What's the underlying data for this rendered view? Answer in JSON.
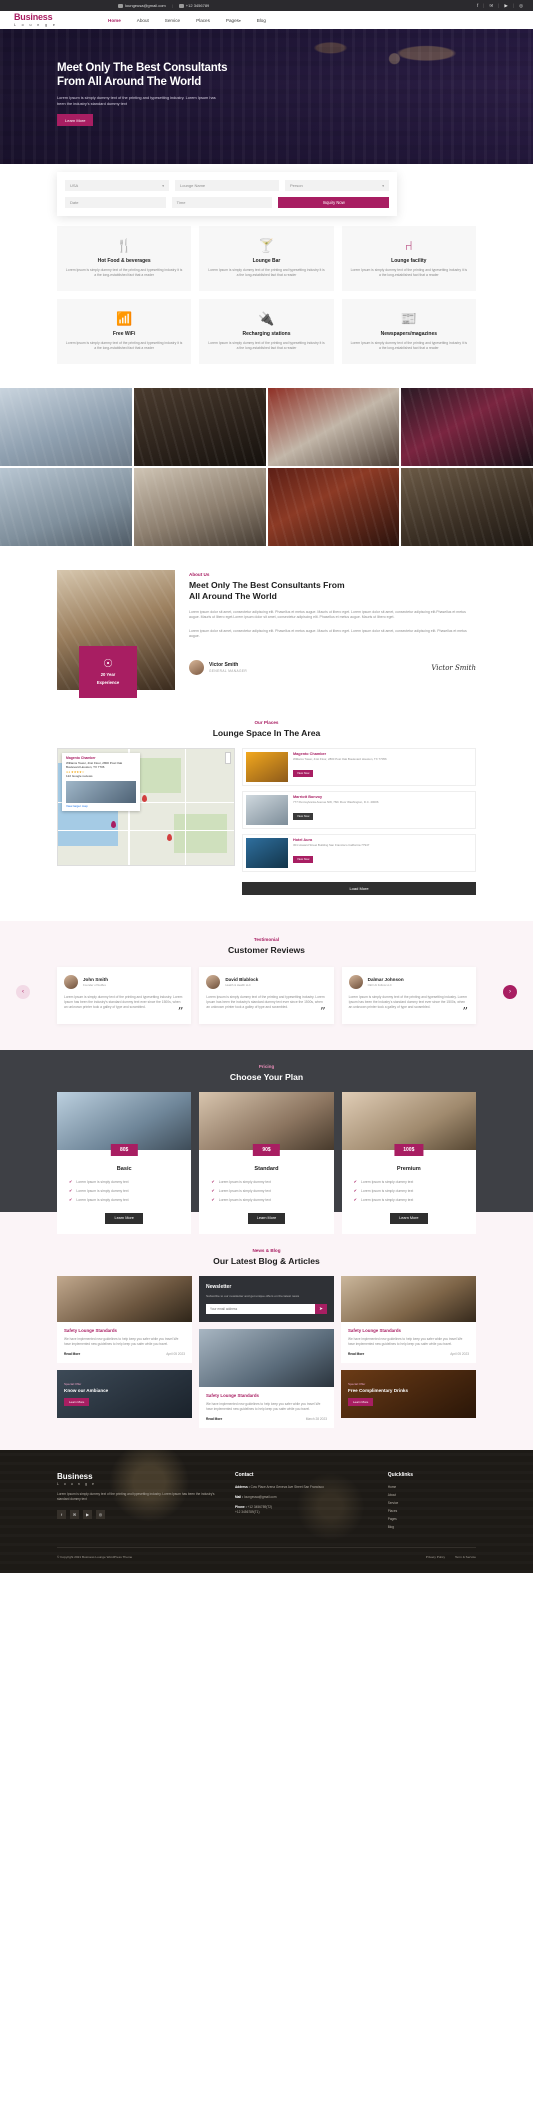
{
  "topbar": {
    "email": "loungeusa@gmail.com",
    "phone": "+12 3456789",
    "email_icon": "mail-icon",
    "phone_icon": "phone-icon",
    "social": [
      {
        "name": "facebook-icon",
        "glyph": "f"
      },
      {
        "name": "twitter-icon",
        "glyph": "✉"
      },
      {
        "name": "youtube-icon",
        "glyph": "▶"
      },
      {
        "name": "instagram-icon",
        "glyph": "◎"
      }
    ]
  },
  "brand": {
    "name": "Business",
    "sub": "L o u n g e"
  },
  "nav": {
    "items": [
      {
        "label": "Home",
        "active": true
      },
      {
        "label": "About",
        "active": false
      },
      {
        "label": "Service",
        "active": false
      },
      {
        "label": "Places",
        "active": false
      },
      {
        "label": "Pages",
        "active": false,
        "caret": "▾"
      },
      {
        "label": "Blog",
        "active": false
      }
    ]
  },
  "hero": {
    "title_line1": "Meet Only The Best Consultants",
    "title_line2": "From All Around The World",
    "paragraph": "Lorem Ipsum is simply dummy text of the printing and typesetting industry. Lorem Ipsum has been the industry's standard dummy text",
    "cta": "Learn More"
  },
  "booking": {
    "country": "USA",
    "country_caret": "▾",
    "lounge": "Lounge Name",
    "person": "Person",
    "date": "Date",
    "time": "Time",
    "submit": "Inquiry Now"
  },
  "services": {
    "cards": [
      {
        "icon": "cutlery-icon",
        "glyph": "🍴",
        "title": "Hot Food & beverages",
        "text": "Lorem Ipsum is simply dummy text of the printing and typesetting industry it is a the long-established fact that a reader"
      },
      {
        "icon": "cocktail-icon",
        "glyph": "🍸",
        "title": "Lounge Bar",
        "text": "Lorem Ipsum is simply dummy text of the printing and typesetting industry it is a the long-established fact that a reader"
      },
      {
        "icon": "lounge-chair-icon",
        "glyph": "⑁",
        "title": "Lounge facility",
        "text": "Lorem Ipsum is simply dummy text of the printing and typesetting industry it is a the long-established fact that a reader"
      },
      {
        "icon": "wifi-icon",
        "glyph": "📶",
        "title": "Free WiFi",
        "text": "Lorem Ipsum is simply dummy text of the printing and typesetting industry it is a the long-established fact that a reader"
      },
      {
        "icon": "battery-charge-icon",
        "glyph": "🔌",
        "title": "Recharging stations",
        "text": "Lorem Ipsum is simply dummy text of the printing and typesetting industry it is a the long-established fact that a reader"
      },
      {
        "icon": "newspaper-icon",
        "glyph": "📰",
        "title": "Newspapers/magazines",
        "text": "Lorem Ipsum is simply dummy text of the printing and typesetting industry it is a the long-established fact that a reader"
      }
    ]
  },
  "gallery": {
    "row1": [
      "airport-lounge-photo",
      "garden-lounge-photo",
      "red-interior-photo",
      "bar-night-photo"
    ],
    "row2": [
      "library-lounge-photo",
      "dining-room-photo",
      "billiards-room-photo",
      "people-lounge-photo"
    ]
  },
  "about": {
    "eyebrow": "About Us",
    "title_line1": "Meet Only The Best Consultants From",
    "title_line2": "All Around The World",
    "badge_years": "20 Year",
    "badge_label": "Experience",
    "badge_icon": "award-medal-icon",
    "p1": "Lorem ipsum dolor sit amet, consectetur adipiscing elit. Phasellus et metus augue. Mauris ut libero eget. Lorem ipsum dolor sit amet, consectetur adipiscing elit.Phasellus et metus augue. Mauris ut libero eget.Lorem ipsum dolor sit amet, consectetur adipiscing elit. Phasellus et metus augue. Mauris ut libero eget.",
    "p2": "Lorem ipsum dolor sit amet, consectetur adipiscing elit. Phasellus et metus augue. Mauris ut libero eget. Lorem ipsum dolor sit amet, consectetur adipiscing elit. Phasellus et metus augue.",
    "author_name": "Victor Smith",
    "author_role": "GENERAL MANAGER",
    "signature": "Victor Smith"
  },
  "places": {
    "eyebrow": "Our Places",
    "title": "Lounge Space In The Area",
    "map_card": {
      "title": "Magento Chamber",
      "address": "Williams Tower, 41st Floor, 2800 Post Oak Boulevard Houston, TX 7706",
      "rating": "4.1 ★★★★☆",
      "reviews": "122 Google reviews",
      "link": "View larger map"
    },
    "items": [
      {
        "name": "Magento Chamber",
        "address": "Williams Tower, 41st Floor, 2800 Post Oak Boulevard Houston, TX 77056",
        "button": "View Now",
        "thumb": "orange-meeting-room-photo"
      },
      {
        "name": "Marriott Bonvoy",
        "address": "777 Pennsylvania Avenue NW, 76th Floor Washington, D.C. 20006",
        "button": "View Now",
        "thumb": "white-conference-room-photo"
      },
      {
        "name": "Hotel Aura",
        "address": "301 Howard Street Building San Francisco California 77947",
        "button": "View Now",
        "thumb": "blue-lounge-photo"
      }
    ],
    "load_more": "Load More"
  },
  "testimonial": {
    "eyebrow": "Testimonial",
    "title": "Customer Reviews",
    "cards": [
      {
        "name": "John Smith",
        "role": "Founder of Netflex",
        "text": "Lorem Ipsum is simply dummy text of the printing and typesetting industry. Lorem Ipsum has been the industry's standard dummy text ever since the 1500s, when an unknown printer took a galley of type and scrambled."
      },
      {
        "name": "David Blablock",
        "role": "Health & Health LLC",
        "text": "Lorem Ipsum is simply dummy text of the printing and typesetting industry. Lorem Ipsum has been the industry's standard dummy text ever since the 1500s, when an unknown printer took a galley of type and scrambled."
      },
      {
        "name": "Dalmar Johnson",
        "role": "CEO At Follow LLC",
        "text": "Lorem Ipsum is simply dummy text of the printing and typesetting industry. Lorem Ipsum has been the industry's standard dummy text ever since the 1500s, when an unknown printer took a galley of type and scrambled."
      }
    ],
    "prev": "‹",
    "next": "›",
    "quote_glyph": "”"
  },
  "pricing": {
    "eyebrow": "Pricing",
    "title": "Choose Your  Plan",
    "plans": [
      {
        "price": "80$",
        "name": "Basic",
        "features": [
          "Lorem Ipsum is simply dummy text",
          "Lorem Ipsum is simply dummy text",
          "Lorem Ipsum is simply dummy text"
        ],
        "button": "Learn More"
      },
      {
        "price": "90$",
        "name": "Standard",
        "features": [
          "Lorem Ipsum is simply dummy text",
          "Lorem Ipsum is simply dummy text",
          "Lorem Ipsum is simply dummy text"
        ],
        "button": "Learn More"
      },
      {
        "price": "100$",
        "name": "Premium",
        "features": [
          "Lorem Ipsum is simply dummy text",
          "Lorem Ipsum is simply dummy text",
          "Lorem Ipsum is simply dummy text"
        ],
        "button": "Learn More"
      }
    ],
    "check_glyph": "✔"
  },
  "blog": {
    "eyebrow": "News & Blog",
    "title": "Our Latest Blog & Articles",
    "posts": [
      {
        "title": "Safety Lounge Standards",
        "text": "We have implemented new guidelines to help keep you safer while you travel.We have implemented new guidelines to help keep you safer while you travel.",
        "read_more": "Read More",
        "date": "April 05 2023",
        "thumb": "cafe-people-photo"
      },
      {
        "title": "Safety Lounge Standards",
        "text": "We have implemented new guidelines to help keep you safer while you travel.We have implemented new guidelines to help keep you safer while you travel.",
        "read_more": "Read More",
        "date": "March 28 2023",
        "thumb": "hotel-checkin-photo"
      },
      {
        "title": "Safety Lounge Standards",
        "text": "We have implemented new guidelines to help keep you safer while you travel.We have implemented new guidelines to help keep you safer while you travel.",
        "read_more": "Read More",
        "date": "April 05 2023",
        "thumb": "coworking-photo"
      }
    ],
    "newsletter": {
      "title": "Newsletter",
      "text": "Subscribe to our newsletter and get unique offers on the latest news",
      "placeholder": "Your email address",
      "button": "➤"
    },
    "offers": [
      {
        "tag": "Special Offer",
        "title": "Know our Ambiance",
        "button": "Learn More",
        "thumb": "ambiance-photo"
      },
      {
        "tag": "Special Offer",
        "title": "Free Complimentary Drinks",
        "button": "Learn More",
        "thumb": "drinks-photo"
      }
    ]
  },
  "footer": {
    "brand": "Business",
    "brand_sub": "L o u n g e",
    "about": "Lorem Ipsum is simply dummy text of the printing and typesetting industry. Lorem Ipsum has been the industry's standard dummy text",
    "social": [
      {
        "name": "facebook-icon",
        "glyph": "f"
      },
      {
        "name": "twitter-icon",
        "glyph": "✉"
      },
      {
        "name": "youtube-icon",
        "glyph": "▶"
      },
      {
        "name": "instagram-icon",
        "glyph": "◎"
      }
    ],
    "contact_title": "Contact",
    "address_label": "Address :",
    "address": "Cow Place Arena Geneva Ave Street San Francisco",
    "mail_label": "Mail :",
    "mail": "loungeusa@gmail.com",
    "phone_label": "Phone :",
    "phone1": "+12 3456789(T2)",
    "phone2": "+12 3456789(T1)",
    "quicklinks_title": "Quicklinks",
    "quicklinks": [
      "Home",
      "About",
      "Service",
      "Places",
      "Pages",
      "Blog"
    ],
    "copyright": "© Copyright 2021 Business Lounge WordPress Theme",
    "links": [
      "Privacy Policy",
      "Term & Service"
    ]
  },
  "colors": {
    "accent": "#a81e62",
    "dark": "#2f2f2f",
    "panel": "#3e4045",
    "soft": "#fbf4f7"
  }
}
